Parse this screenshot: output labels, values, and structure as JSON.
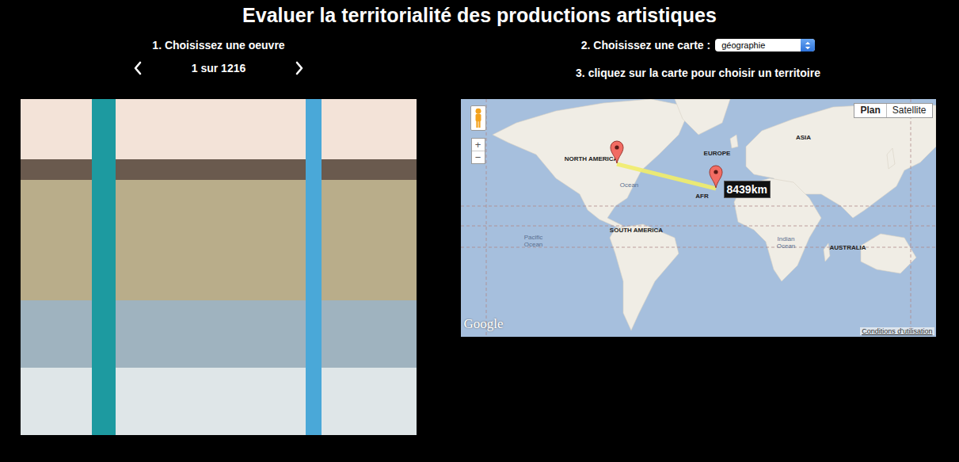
{
  "title": "Evaluer la territorialité des productions artistiques",
  "artwork_picker": {
    "label": "1. Choisissez une oeuvre",
    "position": "1 sur 1216"
  },
  "map_picker": {
    "label": "2. Choisissez une carte :",
    "select": {
      "value": "géographie"
    },
    "instruction": "3. cliquez sur la carte pour choisir un territoire"
  },
  "map": {
    "map_types": [
      {
        "label": "Plan",
        "selected": true
      },
      {
        "label": "Satellite",
        "selected": false
      }
    ],
    "zoom": [
      "+",
      "−"
    ],
    "labels": [
      {
        "text": "NORTH AMERICA",
        "kind": "continent"
      },
      {
        "text": "EUROPE",
        "kind": "continent"
      },
      {
        "text": "ASIA",
        "kind": "continent"
      },
      {
        "text": "AFR",
        "kind": "continent"
      },
      {
        "text": "Ocean",
        "kind": "ocean"
      },
      {
        "text": "SOUTH AMERICA",
        "kind": "continent"
      },
      {
        "text": "Pacific Ocean",
        "kind": "ocean"
      },
      {
        "text": "Indian Ocean",
        "kind": "ocean"
      },
      {
        "text": "AUSTRALIA",
        "kind": "continent"
      }
    ],
    "distance": "8439km",
    "provider": "Google",
    "terms": "Conditions d'utilisation"
  }
}
